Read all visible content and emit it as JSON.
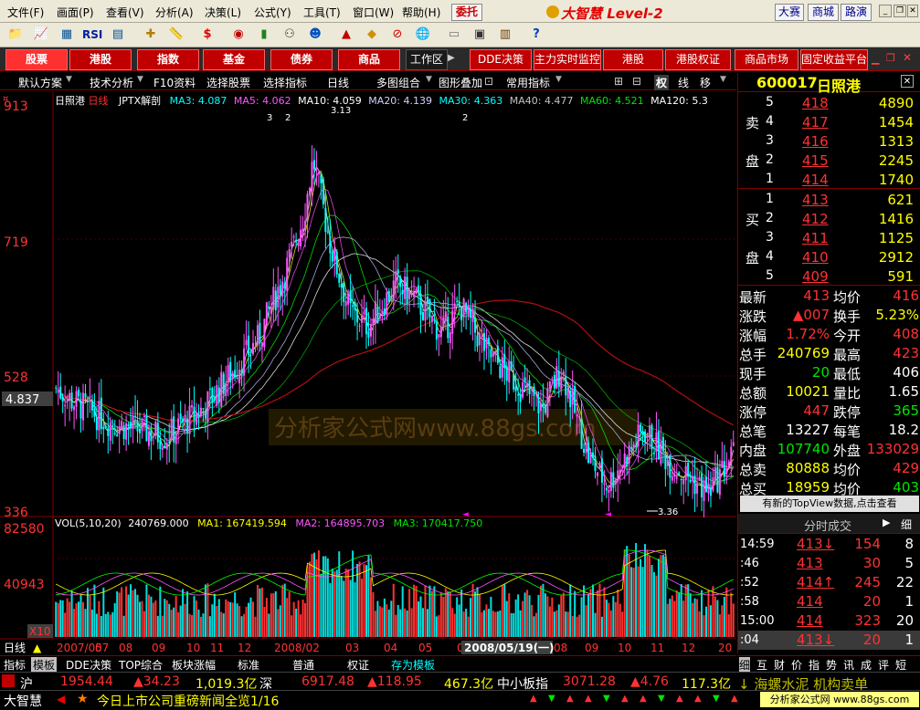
{
  "menu": {
    "items": [
      "文件(F)",
      "画面(P)",
      "查看(V)",
      "分析(A)",
      "决策(L)",
      "公式(Y)",
      "工具(T)",
      "窗口(W)",
      "帮助(H)"
    ],
    "entrust": "委托",
    "brand": "大智慧 Level-2",
    "right_buttons": [
      "大赛",
      "商城",
      "路演"
    ]
  },
  "tabs": [
    "股票",
    "港股",
    "指数",
    "基金",
    "债券",
    "商品"
  ],
  "workspace": "工作区",
  "tabs2": [
    "DDE决策",
    "主力实时监控",
    "港股",
    "港股权证",
    "商品市场",
    "固定收益平台"
  ],
  "subbar": [
    "默认方案",
    "技术分析",
    "F10资料",
    "选择股票",
    "选择指标",
    "日线",
    "多图组合",
    "图形叠加",
    "常用指标"
  ],
  "view_icons": [
    "权",
    "线",
    "移"
  ],
  "chart_header": {
    "name": "日照港",
    "period": "日线",
    "formula": "JPTX解剖",
    "ma": [
      "MA3: 4.087",
      "MA5: 4.062",
      "MA10: 4.059",
      "MA20: 4.139",
      "MA30: 4.363",
      "MA40: 4.477",
      "MA60: 4.521",
      "MA120: 5.3"
    ],
    "marks": [
      "3",
      "2",
      "3.13",
      "2"
    ]
  },
  "chart_data": [
    {
      "type": "candlestick",
      "title": "日照港 日线",
      "y_ticks": [
        "913",
        "719",
        "528",
        "4.837",
        "336"
      ],
      "annotations": [
        "3.13",
        "3.36"
      ],
      "ma_lines": [
        "MA3",
        "MA5",
        "MA10",
        "MA20",
        "MA30",
        "MA40",
        "MA60",
        "MA120"
      ]
    },
    {
      "type": "bar",
      "title": "VOL(5,10,20)",
      "values_text": [
        "240769.000",
        "MA1: 167419.594",
        "MA2: 164895.703",
        "MA3: 170417.750"
      ],
      "y_ticks": [
        "82580",
        "40943",
        "X10"
      ],
      "x_ticks": [
        "2007/05",
        "07",
        "08",
        "09",
        "10",
        "11",
        "12",
        "2008/02",
        "03",
        "04",
        "05",
        "06",
        "07",
        "08",
        "09",
        "10",
        "11",
        "12",
        "20"
      ]
    }
  ],
  "watermark": "分析家公式网www.88gs.com",
  "cursor_date": "2008/05/19(一)",
  "right_panel": {
    "code": "600017",
    "name": "日照港",
    "sell_label": [
      "卖",
      "盘"
    ],
    "buy_label": [
      "买",
      "盘"
    ],
    "sells": [
      {
        "lvl": "5",
        "price": "418",
        "vol": "4890"
      },
      {
        "lvl": "4",
        "price": "417",
        "vol": "1454"
      },
      {
        "lvl": "3",
        "price": "416",
        "vol": "1313"
      },
      {
        "lvl": "2",
        "price": "415",
        "vol": "2245"
      },
      {
        "lvl": "1",
        "price": "414",
        "vol": "1740"
      }
    ],
    "buys": [
      {
        "lvl": "1",
        "price": "413",
        "vol": "621"
      },
      {
        "lvl": "2",
        "price": "412",
        "vol": "1416"
      },
      {
        "lvl": "3",
        "price": "411",
        "vol": "1125"
      },
      {
        "lvl": "4",
        "price": "410",
        "vol": "2912"
      },
      {
        "lvl": "5",
        "price": "409",
        "vol": "591"
      }
    ],
    "stats": [
      [
        "最新",
        "413",
        "均价",
        "416"
      ],
      [
        "涨跌",
        "▲007",
        "换手",
        "5.23%"
      ],
      [
        "涨幅",
        "1.72%",
        "今开",
        "408"
      ],
      [
        "总手",
        "240769",
        "最高",
        "423"
      ],
      [
        "现手",
        "20",
        "最低",
        "406"
      ],
      [
        "总额",
        "10021",
        "量比",
        "1.65"
      ],
      [
        "涨停",
        "447",
        "跌停",
        "365"
      ],
      [
        "总笔",
        "13227",
        "每笔",
        "18.2"
      ],
      [
        "内盘",
        "107740",
        "外盘",
        "133029"
      ],
      [
        "总卖",
        "80888",
        "均价",
        "429"
      ],
      [
        "总买",
        "18959",
        "均价",
        "403"
      ]
    ],
    "topview": "有新的TopView数据,点击查看",
    "ticks_title": "分时成交",
    "ticks_btn": "细",
    "ticks": [
      [
        "14:59",
        "413↓",
        "154",
        "8"
      ],
      [
        ":46",
        "413",
        "30",
        "5"
      ],
      [
        ":52",
        "414↑",
        "245",
        "22"
      ],
      [
        ":58",
        "414",
        "20",
        "1"
      ],
      [
        "15:00",
        "414",
        "323",
        "20"
      ],
      [
        ":04",
        "413↓",
        "20",
        "1"
      ]
    ],
    "bottom_tabs": [
      "细",
      "互",
      "财",
      "价",
      "指",
      "势",
      "讯",
      "成",
      "评",
      "短"
    ]
  },
  "bottom_tabs": [
    "指标",
    "模板",
    "DDE决策",
    "TOP综合",
    "板块涨幅",
    "标准",
    "普通",
    "权证",
    "存为模板"
  ],
  "status": {
    "sh_label": "沪",
    "sh_index": "1954.44",
    "sh_change": "▲34.23",
    "sh_amount": "1,019.3亿",
    "sz_label": "深",
    "sz_index": "6917.48",
    "sz_change": "▲118.95",
    "sz_amount": "467.3亿",
    "zx_label": "中小板指",
    "zx_index": "3071.28",
    "zx_change": "▲4.76",
    "zx_amount": "117.3亿",
    "ticker": "↓ 海螺水泥 机构卖单"
  },
  "news": {
    "logo": "大智慧",
    "text": "今日上市公司重磅新闻全览1/16",
    "site": "分析家公式网 www.88gs.com"
  },
  "colors": {
    "up": "#ff3232",
    "down": "#00e600",
    "frame": "#800000",
    "ma120": "#a01010"
  }
}
